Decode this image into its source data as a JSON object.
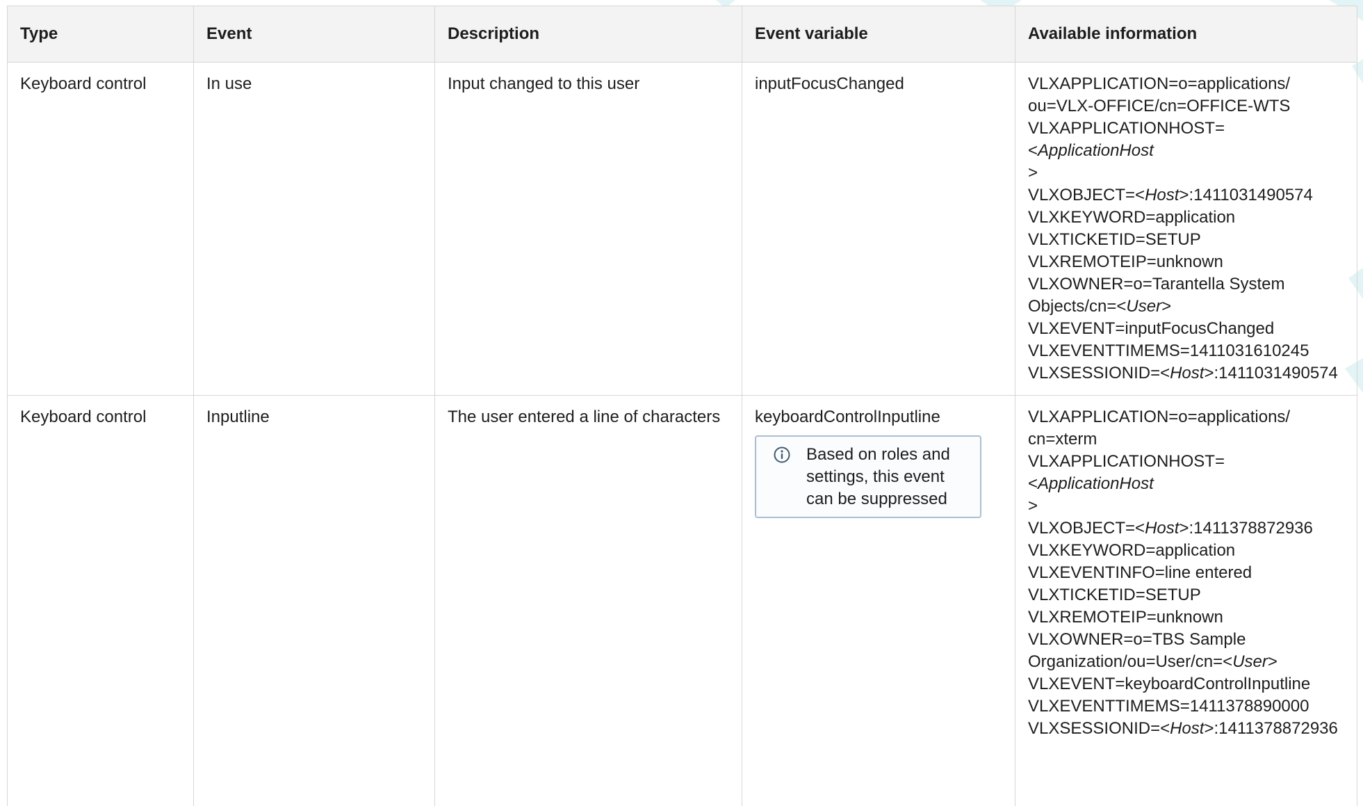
{
  "table": {
    "headers": [
      "Type",
      "Event",
      "Description",
      "Event variable",
      "Available information"
    ],
    "rows": [
      {
        "type": "Keyboard control",
        "event": "In use",
        "description": "Input changed to this user",
        "event_variable": "inputFocusChanged",
        "info_lines": [
          [
            {
              "t": "VLXAPPLICATION=o=applications/"
            }
          ],
          [
            {
              "t": "ou=VLX-OFFICE/cn=OFFICE-WTS"
            }
          ],
          [
            {
              "t": "VLXAPPLICATIONHOST=<"
            },
            {
              "t": "ApplicationHost",
              "i": true
            }
          ],
          [
            {
              "t": ">"
            }
          ],
          [
            {
              "t": "VLXOBJECT=<"
            },
            {
              "t": "Host",
              "i": true
            },
            {
              "t": ">:1411031490574"
            }
          ],
          [
            {
              "t": "VLXKEYWORD=application"
            }
          ],
          [
            {
              "t": "VLXTICKETID=SETUP"
            }
          ],
          [
            {
              "t": "VLXREMOTEIP=unknown"
            }
          ],
          [
            {
              "t": "VLXOWNER=o=Tarantella System"
            }
          ],
          [
            {
              "t": "Objects/cn=<"
            },
            {
              "t": "User",
              "i": true
            },
            {
              "t": ">"
            }
          ],
          [
            {
              "t": "VLXEVENT=inputFocusChanged"
            }
          ],
          [
            {
              "t": "VLXEVENTTIMEMS=1411031610245"
            }
          ],
          [
            {
              "t": "VLXSESSIONID=<"
            },
            {
              "t": "Host",
              "i": true
            },
            {
              "t": ">:1411031490574"
            }
          ]
        ]
      },
      {
        "type": "Keyboard control",
        "event": "Inputline",
        "description": "The user entered a line of characters",
        "event_variable": "keyboardControlInputline",
        "note": "Based on roles and settings, this event can be suppressed",
        "info_lines": [
          [
            {
              "t": "VLXAPPLICATION=o=applications/"
            }
          ],
          [
            {
              "t": "cn=xterm"
            }
          ],
          [
            {
              "t": "VLXAPPLICATIONHOST=<"
            },
            {
              "t": "ApplicationHost",
              "i": true
            }
          ],
          [
            {
              "t": ">"
            }
          ],
          [
            {
              "t": "VLXOBJECT=<"
            },
            {
              "t": "Host",
              "i": true
            },
            {
              "t": ">:1411378872936"
            }
          ],
          [
            {
              "t": "VLXKEYWORD=application"
            }
          ],
          [
            {
              "t": "VLXEVENTINFO=line entered"
            }
          ],
          [
            {
              "t": "VLXTICKETID=SETUP"
            }
          ],
          [
            {
              "t": "VLXREMOTEIP=unknown"
            }
          ],
          [
            {
              "t": "VLXOWNER=o=TBS Sample"
            }
          ],
          [
            {
              "t": "Organization/ou=User/cn=<"
            },
            {
              "t": "User",
              "i": true
            },
            {
              "t": ">"
            }
          ],
          [
            {
              "t": "VLXEVENT=keyboardControlInputline"
            }
          ],
          [
            {
              "t": "VLXEVENTTIMEMS=1411378890000"
            }
          ],
          [
            {
              "t": "VLXSESSIONID=<"
            },
            {
              "t": "Host",
              "i": true
            },
            {
              "t": ">:1411378872936"
            }
          ]
        ]
      }
    ]
  },
  "colors": {
    "header_bg": "#f3f3f3",
    "border": "#d6d6d6",
    "note_border": "#a9bfd1",
    "watermark": "#e3f4f6"
  },
  "icons": {
    "note": "info-circle-icon"
  }
}
